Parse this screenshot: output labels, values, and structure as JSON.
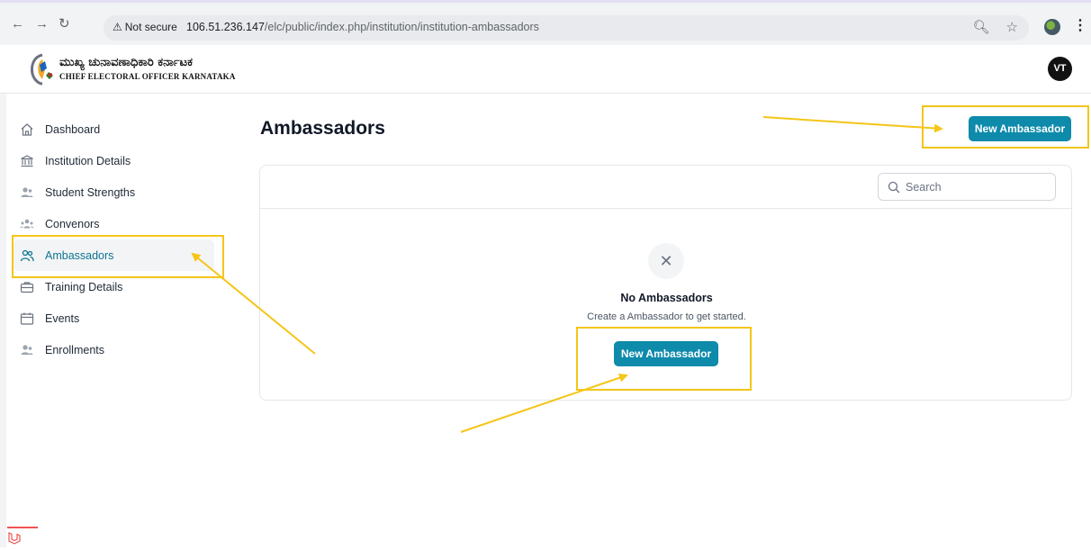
{
  "browser": {
    "security_label": "Not secure",
    "url_host": "106.51.236.147",
    "url_path": "/elc/public/index.php/institution/institution-ambassadors"
  },
  "header": {
    "org_name_kannada": "ಮುಖ್ಯ ಚುನಾವಣಾಧಿಕಾರಿ ಕರ್ನಾಟಕ",
    "org_name_english": "CHIEF ELECTORAL OFFICER KARNATAKA",
    "avatar_initials": "VT"
  },
  "sidebar": {
    "items": [
      {
        "label": "Dashboard",
        "icon": "home-icon"
      },
      {
        "label": "Institution Details",
        "icon": "bank-icon"
      },
      {
        "label": "Student Strengths",
        "icon": "users-icon"
      },
      {
        "label": "Convenors",
        "icon": "user-group-icon"
      },
      {
        "label": "Ambassadors",
        "icon": "users-outline-icon",
        "active": true
      },
      {
        "label": "Training Details",
        "icon": "briefcase-icon"
      },
      {
        "label": "Events",
        "icon": "calendar-icon"
      },
      {
        "label": "Enrollments",
        "icon": "users-icon"
      }
    ]
  },
  "main": {
    "title": "Ambassadors",
    "new_button_label": "New Ambassador",
    "search_placeholder": "Search",
    "empty_title": "No Ambassadors",
    "empty_subtitle": "Create a Ambassador to get started.",
    "empty_button_label": "New Ambassador"
  },
  "colors": {
    "primary": "#0e8aab",
    "highlight": "#f5c518",
    "active_text": "#0e7490"
  }
}
